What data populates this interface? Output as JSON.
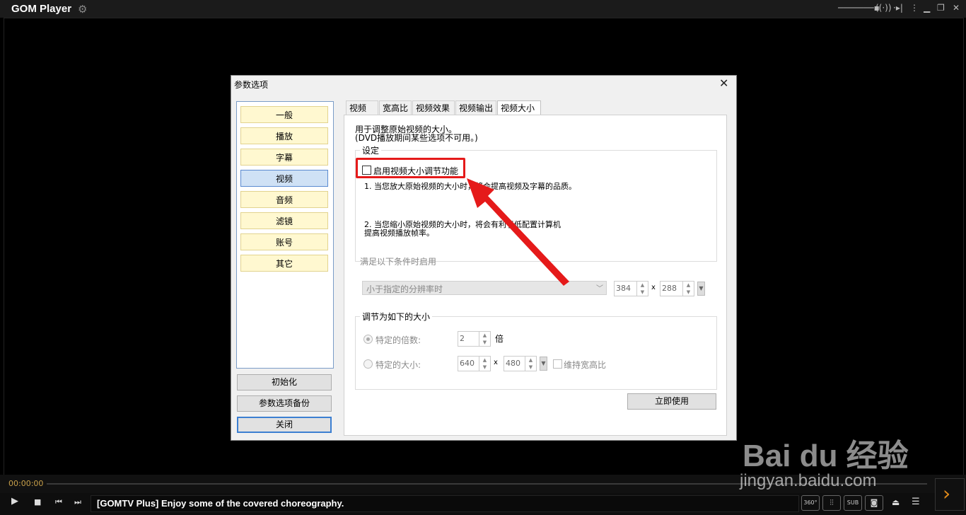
{
  "app": {
    "title": "GOM Player"
  },
  "dialog": {
    "title": "参数选项",
    "categories": [
      "一般",
      "播放",
      "字幕",
      "视频",
      "音频",
      "滤镜",
      "账号",
      "其它"
    ],
    "selected_category": "视频",
    "buttons": {
      "reset": "初始化",
      "backup": "参数选项备份",
      "close": "关闭"
    },
    "tabs": [
      "视频",
      "宽高比",
      "视频效果",
      "视频输出",
      "视频大小"
    ],
    "active_tab": "视频大小",
    "desc1": "用于调整原始视频的大小。",
    "desc2": "(DVD播放期间某些选项不可用。)",
    "settings_group": "设定",
    "enable_checkbox": "启用视频大小调节功能",
    "note1": "1. 当您放大原始视频的大小时，将会提高视频及字幕的品质。",
    "note2a": "2. 当您缩小原始视频的大小时，将会有利于低配置计算机",
    "note2b": "提高视频播放帧率。",
    "condition_group": "满足以下条件时启用",
    "condition_select": "小于指定的分辨率时",
    "res_width": "384",
    "res_height": "288",
    "times": "x",
    "adjust_group": "调节为如下的大小",
    "ratio_label": "特定的倍数:",
    "ratio_value": "2",
    "ratio_unit": "倍",
    "size_label": "特定的大小:",
    "size_width": "640",
    "size_height": "480",
    "keep_aspect": "维持宽高比",
    "apply_button": "立即使用"
  },
  "player": {
    "time": "00:00:00",
    "marquee": "[GOMTV Plus] Enjoy some of the covered choreography.",
    "badges": {
      "vr": "360°",
      "sub": "SUB"
    }
  },
  "watermark": {
    "logo": "Bai du 经验",
    "url": "jingyan.baidu.com"
  },
  "colors": {
    "highlight": "#e51a1a",
    "arrow": "#e51a1a",
    "accent": "#e08a1a"
  }
}
